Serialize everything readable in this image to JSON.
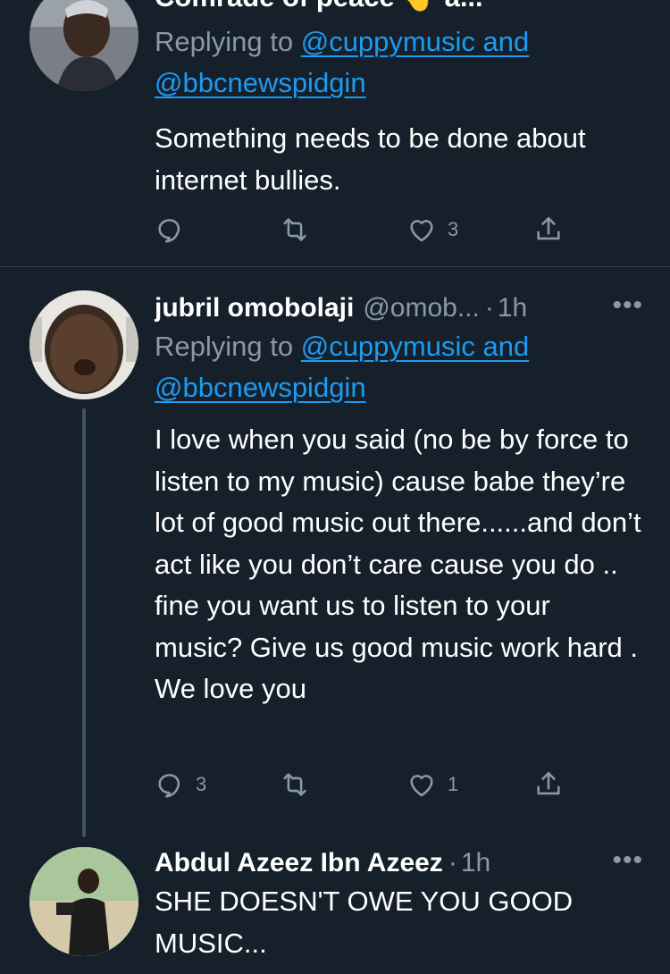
{
  "tweets": [
    {
      "name": "Comrade of peace 🤚 a...",
      "more": "•••",
      "replying_prefix": "Replying to ",
      "mention_1": "@cuppymusic and",
      "mention_2": "@bbcnewspidgin",
      "text": "Something needs to be done about internet bullies.",
      "reply_count": "",
      "retweet_count": "",
      "like_count": "3"
    },
    {
      "name": "jubril omobolaji",
      "handle": "@omob...",
      "dot": "·",
      "time": "1h",
      "more": "•••",
      "replying_prefix": "Replying to ",
      "mention_1": "@cuppymusic and",
      "mention_2": "@bbcnewspidgin",
      "text": "I love when you said (no be by force to listen to my music) cause babe they’re lot of good music out there......and don’t act like you don’t care cause you do .. fine you want us to listen to your music? Give us good music work hard . We love you",
      "reply_count": "3",
      "retweet_count": "",
      "like_count": "1"
    },
    {
      "name": "Abdul Azeez Ibn Azeez",
      "dot": "·",
      "time": "1h",
      "more": "•••",
      "text": "SHE DOESN'T OWE YOU GOOD MUSIC..."
    }
  ],
  "icons": {
    "reply": "reply-icon",
    "retweet": "retweet-icon",
    "like": "heart-icon",
    "share": "share-icon",
    "more": "more-icon"
  },
  "colors": {
    "background": "#15202b",
    "link": "#1d9bf0",
    "secondary_text": "#8b98a5",
    "divider": "#38444d"
  }
}
